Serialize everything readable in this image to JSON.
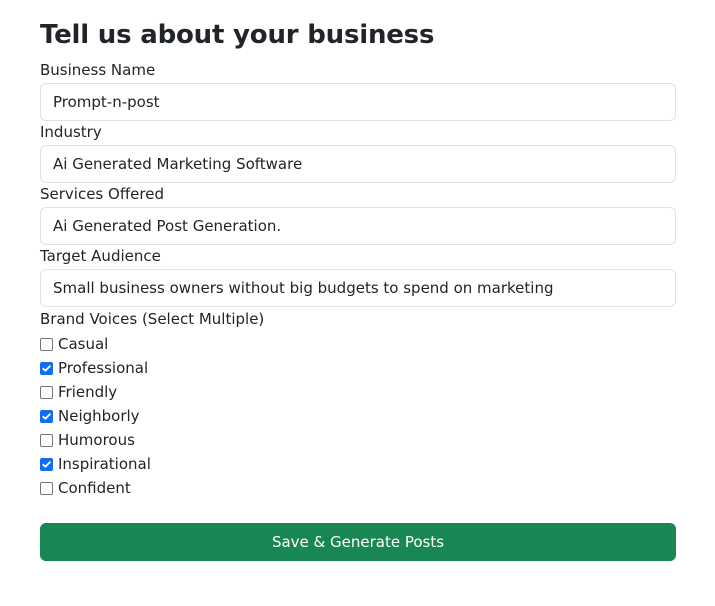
{
  "page": {
    "title": "Tell us about your business"
  },
  "fields": {
    "business_name": {
      "label": "Business Name",
      "value": "Prompt-n-post"
    },
    "industry": {
      "label": "Industry",
      "value": "Ai Generated Marketing Software"
    },
    "services": {
      "label": "Services Offered",
      "value": "Ai Generated Post Generation."
    },
    "audience": {
      "label": "Target Audience",
      "value": "Small business owners without big budgets to spend on marketing"
    }
  },
  "brand_voices": {
    "label": "Brand Voices (Select Multiple)",
    "options": [
      {
        "label": "Casual",
        "checked": false
      },
      {
        "label": "Professional",
        "checked": true
      },
      {
        "label": "Friendly",
        "checked": false
      },
      {
        "label": "Neighborly",
        "checked": true
      },
      {
        "label": "Humorous",
        "checked": false
      },
      {
        "label": "Inspirational",
        "checked": true
      },
      {
        "label": "Confident",
        "checked": false
      }
    ]
  },
  "actions": {
    "submit_label": "Save & Generate Posts"
  },
  "colors": {
    "primary_check": "#0d6efd",
    "submit_bg": "#198754"
  }
}
